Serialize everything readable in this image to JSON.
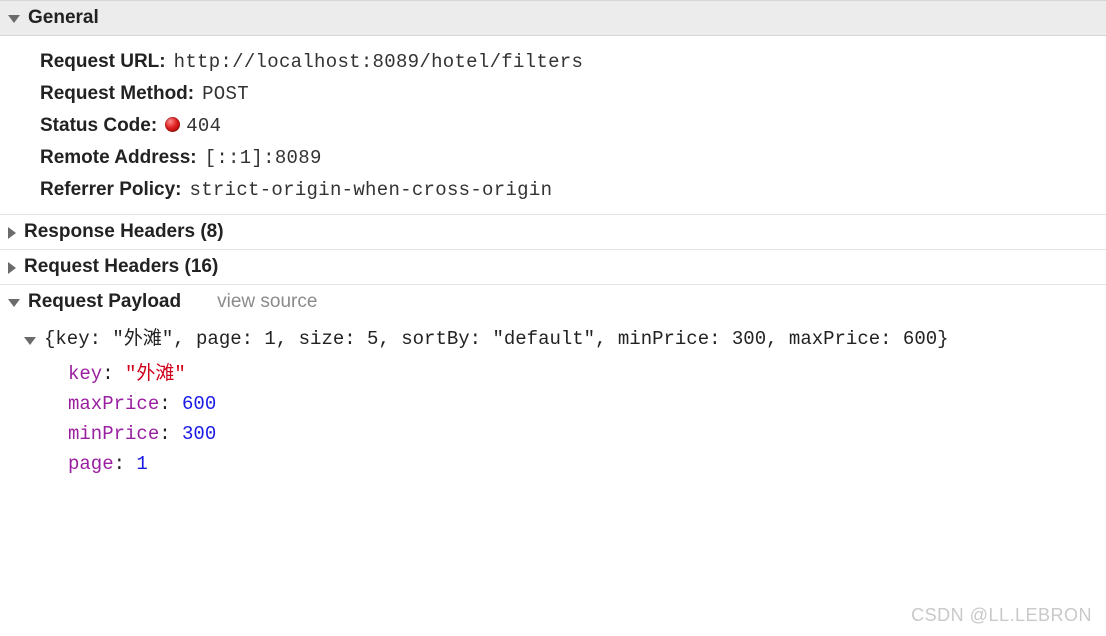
{
  "sections": {
    "general": {
      "title": "General",
      "expanded": true,
      "rows": {
        "request_url": {
          "label": "Request URL:",
          "value": "http://localhost:8089/hotel/filters"
        },
        "request_method": {
          "label": "Request Method:",
          "value": "POST"
        },
        "status_code": {
          "label": "Status Code:",
          "value": "404",
          "dot_color": "#e02020"
        },
        "remote_address": {
          "label": "Remote Address:",
          "value": "[::1]:8089"
        },
        "referrer_policy": {
          "label": "Referrer Policy:",
          "value": "strict-origin-when-cross-origin"
        }
      }
    },
    "response_headers": {
      "title": "Response Headers (8)",
      "expanded": false
    },
    "request_headers": {
      "title": "Request Headers (16)",
      "expanded": false
    },
    "request_payload": {
      "title": "Request Payload",
      "view_source_label": "view source",
      "expanded": true,
      "summary": "{key: \"外滩\", page: 1, size: 5, sortBy: \"default\", minPrice: 300, maxPrice: 600}",
      "entries": [
        {
          "key": "key",
          "value": "\"外滩\"",
          "kind": "str"
        },
        {
          "key": "maxPrice",
          "value": "600",
          "kind": "num"
        },
        {
          "key": "minPrice",
          "value": "300",
          "kind": "num"
        },
        {
          "key": "page",
          "value": "1",
          "kind": "num"
        }
      ]
    }
  },
  "watermark": "CSDN @LL.LEBRON"
}
